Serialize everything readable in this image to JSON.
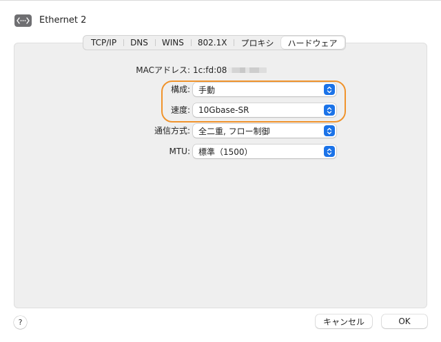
{
  "header": {
    "interface_name": "Ethernet 2",
    "icon": "ethernet-arrows-icon"
  },
  "tabs": [
    {
      "label": "TCP/IP",
      "active": false
    },
    {
      "label": "DNS",
      "active": false
    },
    {
      "label": "WINS",
      "active": false
    },
    {
      "label": "802.1X",
      "active": false
    },
    {
      "label": "プロキシ",
      "active": false
    },
    {
      "label": "ハードウェア",
      "active": true
    }
  ],
  "hardware": {
    "mac_label": "MACアドレス:",
    "mac_value": "1c:fd:08",
    "config_label": "構成:",
    "config_value": "手動",
    "speed_label": "速度:",
    "speed_value": "10Gbase-SR",
    "duplex_label": "通信方式:",
    "duplex_value": "全二重, フロー制御",
    "mtu_label": "MTU:",
    "mtu_value": "標準（1500）"
  },
  "footer": {
    "help_label": "?",
    "cancel_label": "キャンセル",
    "ok_label": "OK"
  },
  "colors": {
    "accent": "#1b73e8",
    "highlight": "#f0932b",
    "panel_bg": "#efefef"
  }
}
